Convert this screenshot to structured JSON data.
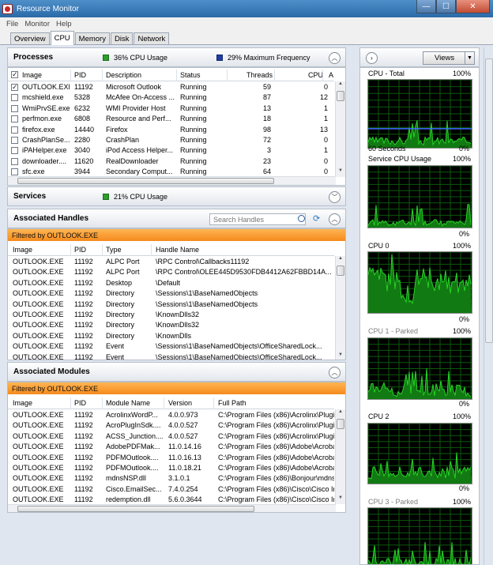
{
  "window": {
    "title": "Resource Monitor",
    "minimize_glyph": "—",
    "maximize_glyph": "☐",
    "close_glyph": "✕"
  },
  "menu": [
    "File",
    "Monitor",
    "Help"
  ],
  "tabs": [
    "Overview",
    "CPU",
    "Memory",
    "Disk",
    "Network"
  ],
  "active_tab": "CPU",
  "processes": {
    "title": "Processes",
    "cpu_usage": "36% CPU Usage",
    "max_freq": "29% Maximum Frequency",
    "columns": [
      "Image",
      "PID",
      "Description",
      "Status",
      "Threads",
      "CPU",
      "A"
    ],
    "rows": [
      {
        "checked": true,
        "image": "OUTLOOK.EXE",
        "pid": "11192",
        "desc": "Microsoft Outlook",
        "status": "Running",
        "threads": "59",
        "cpu": "0"
      },
      {
        "checked": false,
        "image": "mcshield.exe",
        "pid": "5328",
        "desc": "McAfee On-Access ...",
        "status": "Running",
        "threads": "87",
        "cpu": "12"
      },
      {
        "checked": false,
        "image": "WmiPrvSE.exe",
        "pid": "6232",
        "desc": "WMI Provider Host",
        "status": "Running",
        "threads": "13",
        "cpu": "1"
      },
      {
        "checked": false,
        "image": "perfmon.exe",
        "pid": "6808",
        "desc": "Resource and Perf...",
        "status": "Running",
        "threads": "18",
        "cpu": "1"
      },
      {
        "checked": false,
        "image": "firefox.exe",
        "pid": "14440",
        "desc": "Firefox",
        "status": "Running",
        "threads": "98",
        "cpu": "13"
      },
      {
        "checked": false,
        "image": "CrashPlanSe...",
        "pid": "2280",
        "desc": "CrashPlan",
        "status": "Running",
        "threads": "72",
        "cpu": "0"
      },
      {
        "checked": false,
        "image": "iPAHelper.exe",
        "pid": "3040",
        "desc": "iPod Access Helper...",
        "status": "Running",
        "threads": "3",
        "cpu": "1"
      },
      {
        "checked": false,
        "image": "downloader....",
        "pid": "11620",
        "desc": "RealDownloader",
        "status": "Running",
        "threads": "23",
        "cpu": "0"
      },
      {
        "checked": false,
        "image": "sfc.exe",
        "pid": "3944",
        "desc": "Secondary Comput...",
        "status": "Running",
        "threads": "64",
        "cpu": "0"
      }
    ]
  },
  "services": {
    "title": "Services",
    "cpu_usage": "21% CPU Usage"
  },
  "handles": {
    "title": "Associated Handles",
    "search_placeholder": "Search Handles",
    "filter": "Filtered by OUTLOOK.EXE",
    "columns": [
      "Image",
      "PID",
      "Type",
      "Handle Name"
    ],
    "rows": [
      {
        "image": "OUTLOOK.EXE",
        "pid": "11192",
        "type": "ALPC Port",
        "name": "\\RPC Control\\Callbacks11192"
      },
      {
        "image": "OUTLOOK.EXE",
        "pid": "11192",
        "type": "ALPC Port",
        "name": "\\RPC Control\\OLEE445D9530FDB4412A62FBBD14A..."
      },
      {
        "image": "OUTLOOK.EXE",
        "pid": "11192",
        "type": "Desktop",
        "name": "\\Default"
      },
      {
        "image": "OUTLOOK.EXE",
        "pid": "11192",
        "type": "Directory",
        "name": "\\Sessions\\1\\BaseNamedObjects"
      },
      {
        "image": "OUTLOOK.EXE",
        "pid": "11192",
        "type": "Directory",
        "name": "\\Sessions\\1\\BaseNamedObjects"
      },
      {
        "image": "OUTLOOK.EXE",
        "pid": "11192",
        "type": "Directory",
        "name": "\\KnownDlls32"
      },
      {
        "image": "OUTLOOK.EXE",
        "pid": "11192",
        "type": "Directory",
        "name": "\\KnownDlls32"
      },
      {
        "image": "OUTLOOK.EXE",
        "pid": "11192",
        "type": "Directory",
        "name": "\\KnownDlls"
      },
      {
        "image": "OUTLOOK.EXE",
        "pid": "11192",
        "type": "Event",
        "name": "\\Sessions\\1\\BaseNamedObjects\\OfficeSharedLock..."
      },
      {
        "image": "OUTLOOK.EXE",
        "pid": "11192",
        "type": "Event",
        "name": "\\Sessions\\1\\BaseNamedObjects\\OfficeSharedLock..."
      }
    ]
  },
  "modules": {
    "title": "Associated Modules",
    "filter": "Filtered by OUTLOOK.EXE",
    "columns": [
      "Image",
      "PID",
      "Module Name",
      "Version",
      "Full Path"
    ],
    "rows": [
      {
        "image": "OUTLOOK.EXE",
        "pid": "11192",
        "module": "AcrolinxWordP...",
        "version": "4.0.0.973",
        "path": "C:\\Program Files (x86)\\Acrolinx\\Plugi"
      },
      {
        "image": "OUTLOOK.EXE",
        "pid": "11192",
        "module": "AcroPlugInSdk....",
        "version": "4.0.0.527",
        "path": "C:\\Program Files (x86)\\Acrolinx\\Plugi"
      },
      {
        "image": "OUTLOOK.EXE",
        "pid": "11192",
        "module": "ACSS_Junction....",
        "version": "4.0.0.527",
        "path": "C:\\Program Files (x86)\\Acrolinx\\Plugi"
      },
      {
        "image": "OUTLOOK.EXE",
        "pid": "11192",
        "module": "AdobePDFMak...",
        "version": "11.0.14.16",
        "path": "C:\\Program Files (x86)\\Adobe\\Acroba"
      },
      {
        "image": "OUTLOOK.EXE",
        "pid": "11192",
        "module": "PDFMOutlook....",
        "version": "11.0.16.13",
        "path": "C:\\Program Files (x86)\\Adobe\\Acroba"
      },
      {
        "image": "OUTLOOK.EXE",
        "pid": "11192",
        "module": "PDFMOutlook....",
        "version": "11.0.18.21",
        "path": "C:\\Program Files (x86)\\Adobe\\Acroba"
      },
      {
        "image": "OUTLOOK.EXE",
        "pid": "11192",
        "module": "mdnsNSP.dll",
        "version": "3.1.0.1",
        "path": "C:\\Program Files (x86)\\Bonjour\\mdns"
      },
      {
        "image": "OUTLOOK.EXE",
        "pid": "11192",
        "module": "Cisco.EmailSec...",
        "version": "7.4.0.254",
        "path": "C:\\Program Files (x86)\\Cisco\\Cisco Ir"
      },
      {
        "image": "OUTLOOK.EXE",
        "pid": "11192",
        "module": "redemption.dll",
        "version": "5.6.0.3644",
        "path": "C:\\Program Files (x86)\\Cisco\\Cisco Ir"
      }
    ]
  },
  "graphs_panel": {
    "views_label": "Views",
    "graphs": [
      {
        "label": "CPU - Total",
        "max": "100%",
        "min": "0%",
        "sub": "60 Seconds",
        "parked": false
      },
      {
        "label": "Service CPU Usage",
        "max": "100%",
        "min": "0%",
        "sub": "",
        "parked": false
      },
      {
        "label": "CPU 0",
        "max": "100%",
        "min": "0%",
        "sub": "",
        "parked": false
      },
      {
        "label": "CPU 1 - Parked",
        "max": "100%",
        "min": "0%",
        "sub": "",
        "parked": true
      },
      {
        "label": "CPU 2",
        "max": "100%",
        "min": "0%",
        "sub": "",
        "parked": false
      },
      {
        "label": "CPU 3 - Parked",
        "max": "100%",
        "min": "",
        "sub": "",
        "parked": true
      }
    ]
  },
  "colors": {
    "graph_line": "#25d425",
    "graph_fill": "#127a12",
    "grid": "#0c5a0c",
    "freq_line": "#3f6dff",
    "filter_bar": "#f58a1c"
  }
}
